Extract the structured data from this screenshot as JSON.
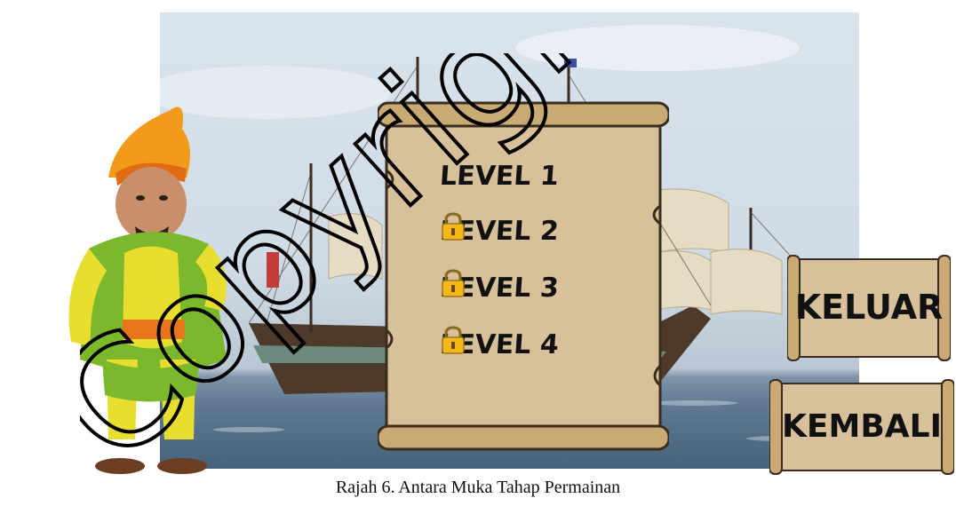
{
  "levels": [
    {
      "label": "LEVEL 1",
      "locked": false
    },
    {
      "label": "LEVEL 2",
      "locked": true
    },
    {
      "label": "LEVEL 3",
      "locked": true
    },
    {
      "label": "LEVEL 4",
      "locked": true
    }
  ],
  "buttons": {
    "exit_label": "KELUAR",
    "back_label": "KEMBALI"
  },
  "caption": "Rajah 6. Antara Muka Tahap Permainan",
  "watermark": "Copyright",
  "colors": {
    "parchment": "#d8c09a",
    "parchment_dark": "#8a6a3e",
    "lock_gold": "#f2b81c",
    "watermark": "#000000"
  }
}
